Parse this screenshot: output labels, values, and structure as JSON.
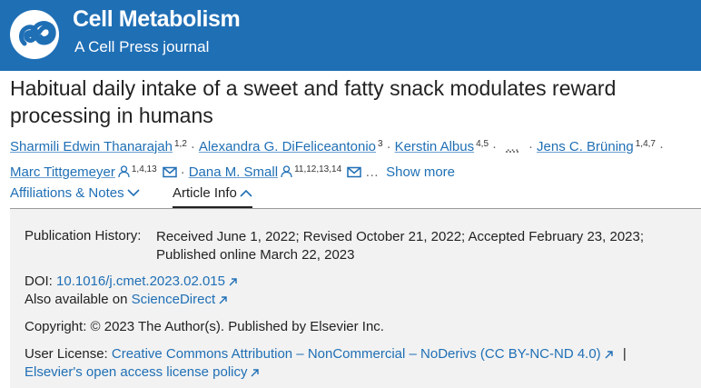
{
  "journal": {
    "name": "Cell Metabolism",
    "subtitle": "A Cell Press journal"
  },
  "article": {
    "title": "Habitual daily intake of a sweet and fatty snack modulates reward processing in humans"
  },
  "authors": {
    "a1_name": "Sharmili Edwin Thanarajah",
    "a1_sup": "1,2",
    "a2_name": "Alexandra G. DiFeliceantonio",
    "a2_sup": "3",
    "a3_name": "Kerstin Albus",
    "a3_sup": "4,5",
    "ellipsis": "…",
    "a4_name": "Jens C. Brüning",
    "a4_sup": "1,4,7",
    "a5_name": "Marc Tittgemeyer",
    "a5_sup": "1,4,13",
    "a6_name": "Dana M. Small",
    "a6_sup": "11,12,13,14",
    "show_more": "Show more"
  },
  "tabs": {
    "affiliations": "Affiliations & Notes",
    "article_info": "Article Info"
  },
  "info": {
    "history_label": "Publication History:",
    "history_value": "Received June 1, 2022; Revised October 21, 2022; Accepted February 23, 2023; Published online March 22, 2023",
    "doi_label": "DOI:",
    "doi_value": "10.1016/j.cmet.2023.02.015",
    "also_label": "Also available on",
    "also_link": "ScienceDirect",
    "copyright": "Copyright: © 2023 The Author(s). Published by Elsevier Inc.",
    "license_label": "User License:",
    "license_link": "Creative Commons Attribution – NonCommercial – NoDerivs (CC BY-NC-ND 4.0)",
    "license_sep": "|",
    "policy_link": "Elsevier's open access license policy"
  },
  "colors": {
    "brand": "#1f6fb5",
    "panel_bg": "#f2f2f2"
  }
}
